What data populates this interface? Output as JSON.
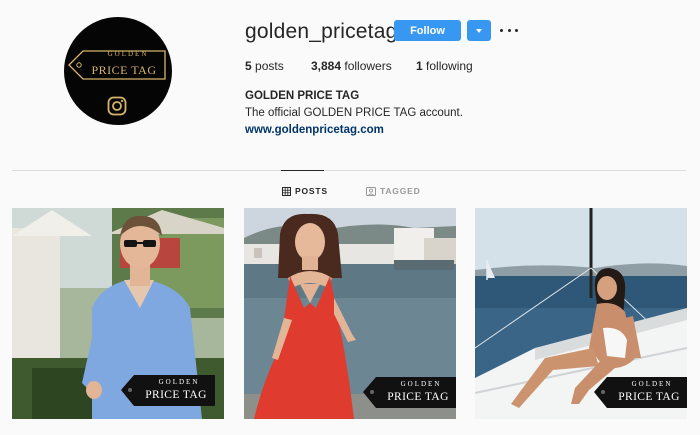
{
  "profile": {
    "username": "golden_pricetag",
    "follow_label": "Follow",
    "stats": [
      {
        "count": "5",
        "label": "posts"
      },
      {
        "count": "3,884",
        "label": "followers"
      },
      {
        "count": "1",
        "label": "following"
      }
    ],
    "bio_name": "GOLDEN PRICE TAG",
    "bio_text": "The official GOLDEN PRICE TAG account.",
    "bio_link": "www.goldenpricetag.com",
    "avatar_logo": {
      "line1": "GOLDEN",
      "line2": "PRICE TAG"
    }
  },
  "tabs": [
    {
      "label": "POSTS",
      "icon": "grid-icon",
      "active": true
    },
    {
      "label": "TAGGED",
      "icon": "tag-icon",
      "active": false
    }
  ],
  "posts": [
    {
      "badge_line1": "GOLDEN",
      "badge_line2": "PRICE TAG",
      "subject": "man-in-blue-shirt"
    },
    {
      "badge_line1": "GOLDEN",
      "badge_line2": "PRICE TAG",
      "subject": "woman-in-red-dress"
    },
    {
      "badge_line1": "GOLDEN",
      "badge_line2": "PRICE TAG",
      "subject": "woman-on-boat"
    }
  ],
  "colors": {
    "accent": "#3897f0",
    "link": "#003569",
    "text": "#262626",
    "muted": "#999999",
    "background": "#fafafa",
    "gold": "#d6b56a"
  }
}
